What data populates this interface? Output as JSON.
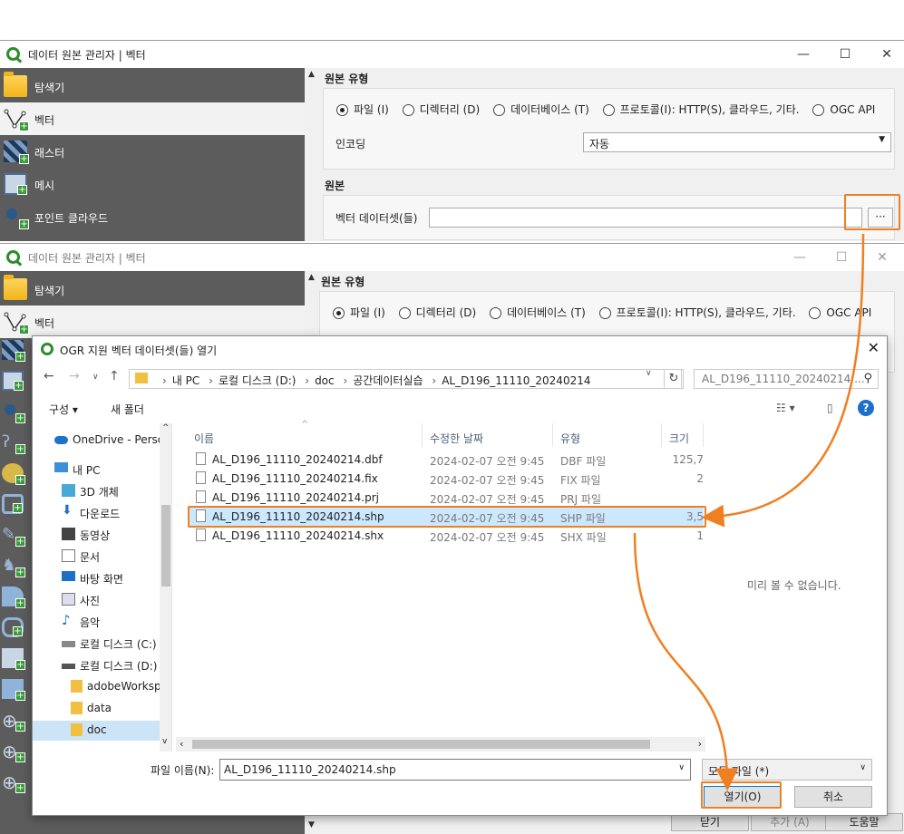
{
  "window1": {
    "title": "데이터 원본 관리자 | 벡터",
    "controls": [
      "—",
      "☐",
      "✕"
    ],
    "sidebar": [
      "탐색기",
      "벡터",
      "래스터",
      "메시",
      "포인트 클라우드"
    ],
    "section_source_type": "원본 유형",
    "radios": [
      "파일 (I)",
      "디렉터리 (D)",
      "데이터베이스 (T)",
      "프로토콜(I): HTTP(S), 클라우드, 기타.",
      "OGC API"
    ],
    "encoding_label": "인코딩",
    "encoding_value": "자동",
    "section_source": "원본",
    "vector_dataset_label": "벡터 데이터셋(들)",
    "browse_label": "···"
  },
  "window2": {
    "title": "데이터 원본 관리자 | 벡터",
    "sidebar": [
      "탐색기",
      "벡터"
    ],
    "section_source_type": "원본 유형",
    "radios": [
      "파일 (I)",
      "디렉터리 (D)",
      "데이터베이스 (T)",
      "프로토콜(I): HTTP(S), 클라우드, 기타.",
      "OGC API"
    ],
    "bottom_buttons": [
      "닫기",
      "추가 (A)",
      "도움말"
    ]
  },
  "dialog": {
    "title": "OGR 지원 벡터 데이터셋(들) 열기",
    "close": "✕",
    "breadcrumb": [
      "내 PC",
      "로컬 디스크 (D:)",
      "doc",
      "공간데이터실습",
      "AL_D196_11110_20240214"
    ],
    "search_placeholder": "AL_D196_11110_20240214 ...",
    "organize": "구성 ▾",
    "new_folder": "새 폴더",
    "nav_items": [
      "OneDrive - Personal",
      "내 PC",
      "3D 개체",
      "다운로드",
      "동영상",
      "문서",
      "바탕 화면",
      "사진",
      "음악",
      "로컬 디스크 (C:)",
      "로컬 디스크 (D:)",
      "adobeWorkspace",
      "data",
      "doc"
    ],
    "columns": [
      "이름",
      "수정한 날짜",
      "유형",
      "크기"
    ],
    "files": [
      {
        "name": "AL_D196_11110_20240214.dbf",
        "date": "2024-02-07 오전 9:45",
        "type": "DBF 파일",
        "size": "125,7"
      },
      {
        "name": "AL_D196_11110_20240214.fix",
        "date": "2024-02-07 오전 9:45",
        "type": "FIX 파일",
        "size": "2"
      },
      {
        "name": "AL_D196_11110_20240214.prj",
        "date": "2024-02-07 오전 9:45",
        "type": "PRJ 파일",
        "size": ""
      },
      {
        "name": "AL_D196_11110_20240214.shp",
        "date": "2024-02-07 오전 9:45",
        "type": "SHP 파일",
        "size": "3,5"
      },
      {
        "name": "AL_D196_11110_20240214.shx",
        "date": "2024-02-07 오전 9:45",
        "type": "SHX 파일",
        "size": "1"
      }
    ],
    "preview_text": "미리 볼 수 없습니다.",
    "filename_label": "파일 이름(N):",
    "filename_value": "AL_D196_11110_20240214.shp",
    "filetype_value": "모든 파일 (*)",
    "open_button": "열기(O)",
    "cancel_button": "취소"
  },
  "colors": {
    "highlight": "#f07f22",
    "selection": "#cce8ff",
    "sidebar": "#5c5c5c"
  }
}
